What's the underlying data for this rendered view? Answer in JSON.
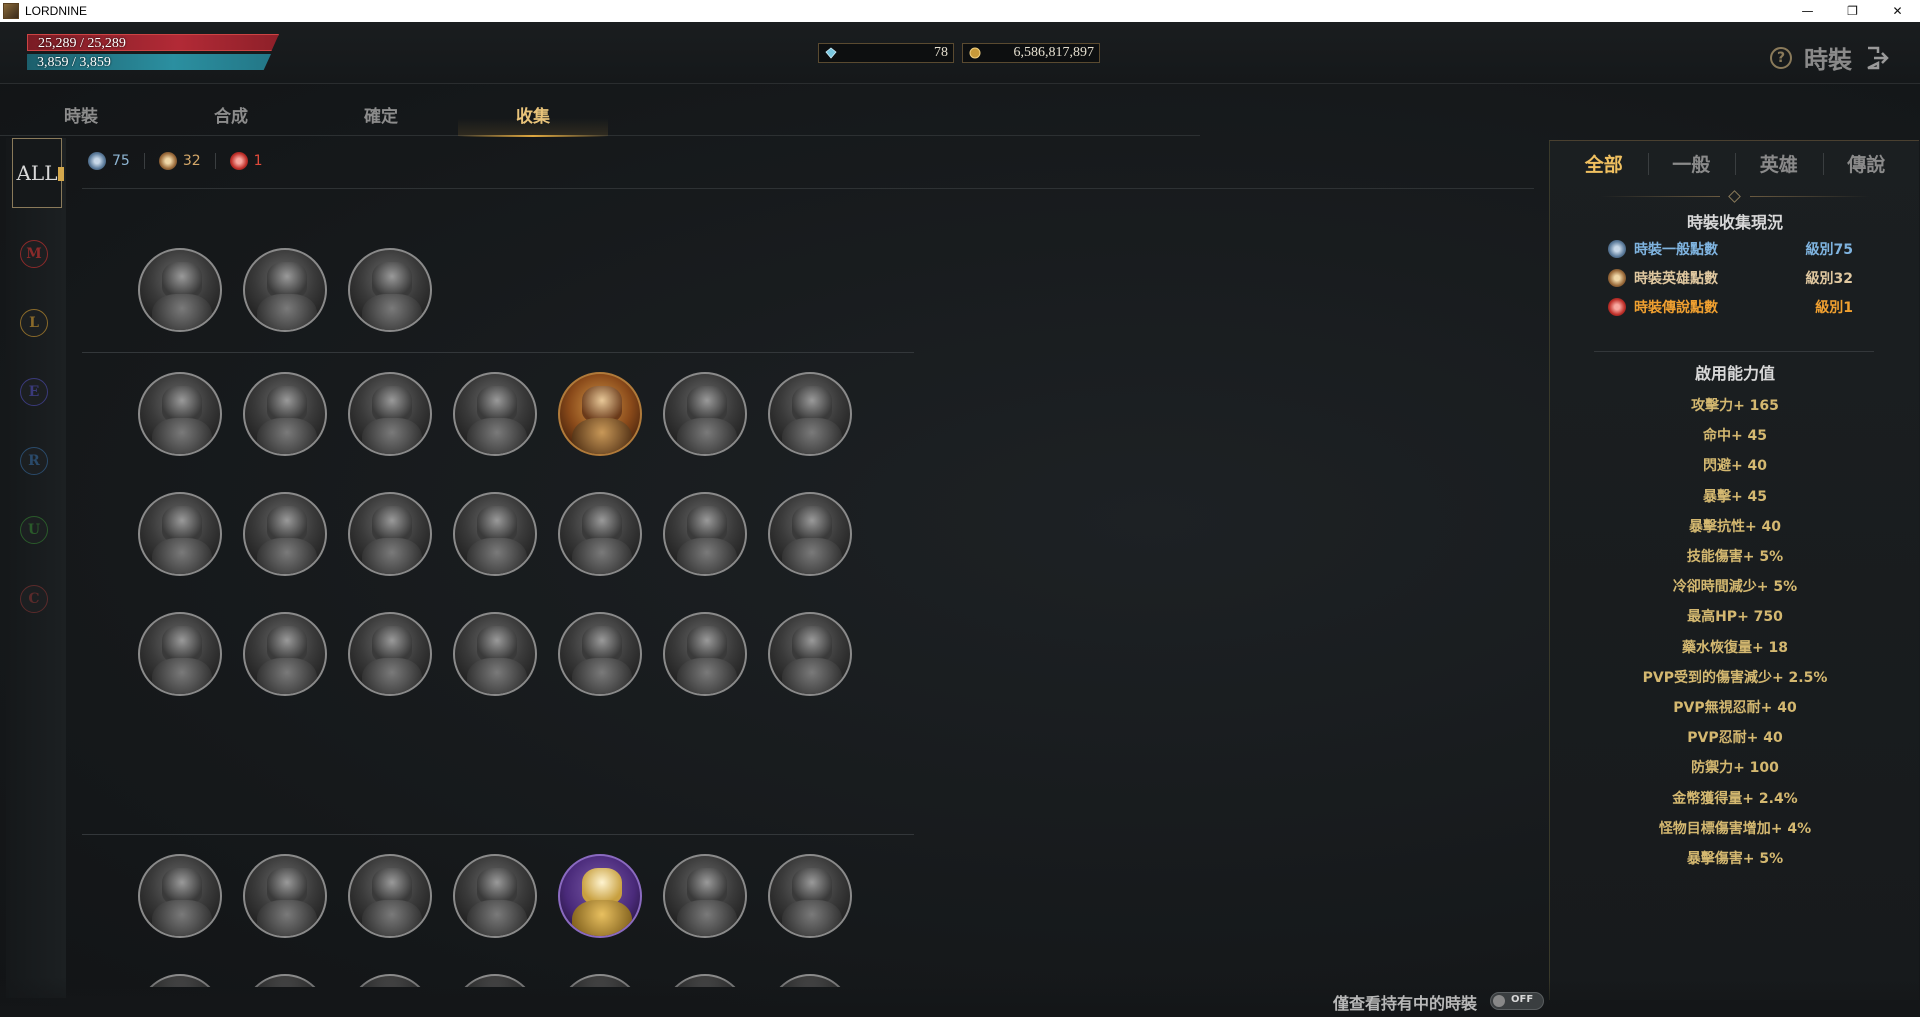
{
  "window": {
    "title": "LORDNINE",
    "minimize": "—",
    "restore": "❐",
    "close": "✕"
  },
  "hud": {
    "hp": "25,289 / 25,289",
    "mp": "3,859 / 3,859",
    "gems": "78",
    "gold": "6,586,817,897",
    "title": "時裝",
    "help_symbol": "?",
    "icons": {
      "help": "help-icon",
      "exit": "exit-icon",
      "gem": "diamond-icon",
      "gold": "gold-coin-icon"
    }
  },
  "tabs": [
    {
      "label": "時裝"
    },
    {
      "label": "合成"
    },
    {
      "label": "確定"
    },
    {
      "label": "收集"
    }
  ],
  "active_tab": "收集",
  "grades": {
    "all": "ALL",
    "items": [
      {
        "letter": "M",
        "color": "#8a2a2a"
      },
      {
        "letter": "L",
        "color": "#8a6a2a"
      },
      {
        "letter": "E",
        "color": "#3a3a7a"
      },
      {
        "letter": "R",
        "color": "#2a4a6a"
      },
      {
        "letter": "U",
        "color": "#2a5a2a"
      },
      {
        "letter": "C",
        "color": "#5a2a2a"
      }
    ]
  },
  "points": {
    "normal": "75",
    "hero": "32",
    "legend": "1",
    "colors": {
      "normal": "#8fb6d4",
      "hero": "#d4a86a",
      "legend": "#e04a3a"
    }
  },
  "collection": {
    "group1_count": 3,
    "group2_rows": [
      [
        "normal",
        "normal",
        "normal",
        "normal",
        "hero",
        "normal",
        "normal"
      ],
      [
        "normal",
        "normal",
        "normal",
        "normal",
        "normal",
        "normal",
        "normal"
      ],
      [
        "normal",
        "normal",
        "normal",
        "normal",
        "normal",
        "normal",
        "normal"
      ]
    ],
    "group3_rows": [
      [
        "normal",
        "normal",
        "normal",
        "normal",
        "legend",
        "normal",
        "normal"
      ],
      [
        "normal",
        "normal",
        "normal",
        "normal",
        "normal",
        "normal",
        "normal"
      ]
    ]
  },
  "right_panel": {
    "tabs": [
      "全部",
      "一般",
      "英雄",
      "傳說"
    ],
    "active_tab": "全部",
    "status_title": "時裝收集現況",
    "status_rows": [
      {
        "name": "時裝一般點數",
        "value": "級別75",
        "color": "#7fb4e0",
        "icon": "normal-point-icon"
      },
      {
        "name": "時裝英雄點數",
        "value": "級別32",
        "color": "#e0c8a0",
        "icon": "hero-point-icon"
      },
      {
        "name": "時裝傳說點數",
        "value": "級別1",
        "color": "#f0a030",
        "icon": "legend-point-icon"
      }
    ],
    "ability_title": "啟用能力值",
    "stats": [
      "攻擊力+ 165",
      "命中+ 45",
      "閃避+ 40",
      "暴擊+ 45",
      "暴擊抗性+ 40",
      "技能傷害+ 5%",
      "冷卻時間減少+ 5%",
      "最高HP+ 750",
      "藥水恢復量+ 18",
      "PVP受到的傷害減少+ 2.5%",
      "PVP無視忍耐+ 40",
      "PVP忍耐+ 40",
      "防禦力+ 100",
      "金幣獲得量+ 2.4%",
      "怪物目標傷害增加+ 4%",
      "暴擊傷害+ 5%"
    ]
  },
  "bottom": {
    "owned_label": "僅查看持有中的時裝",
    "toggle": "OFF"
  }
}
